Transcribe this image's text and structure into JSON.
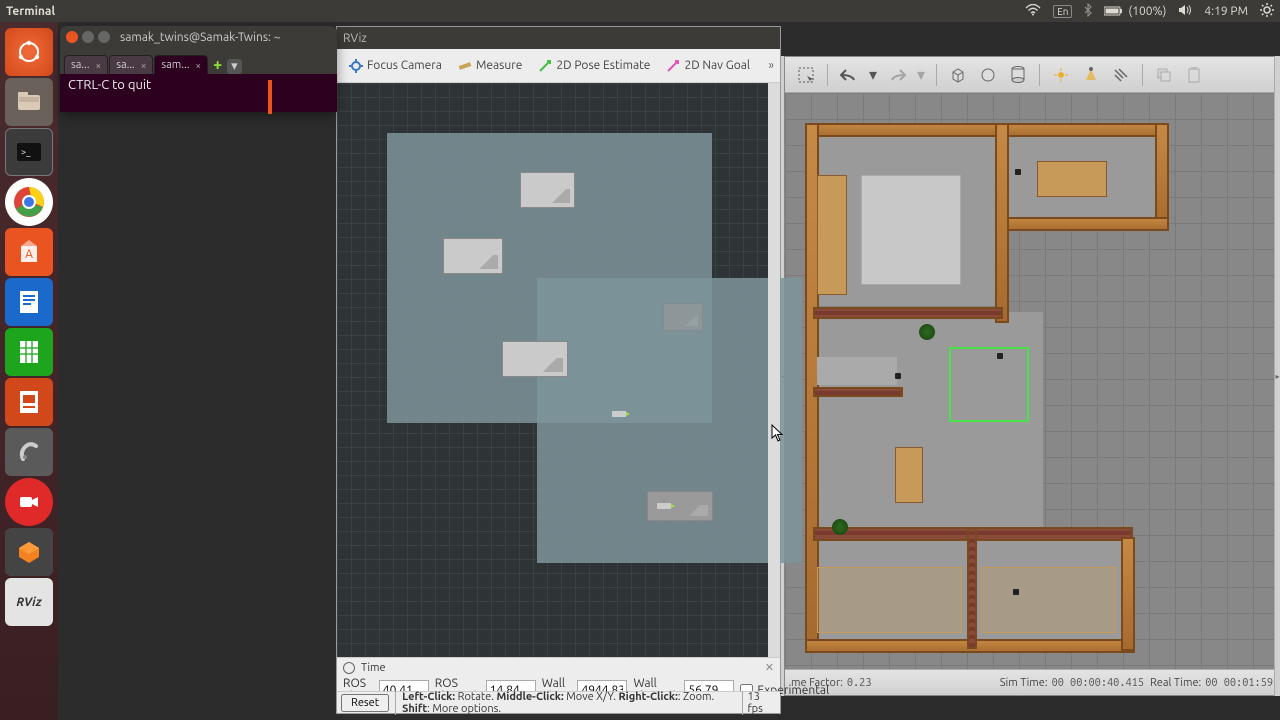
{
  "topbar": {
    "app": "Terminal",
    "lang": "En",
    "battery": "(100%)",
    "time": "4:19 PM"
  },
  "launcher": {
    "items": [
      "logo",
      "files",
      "terminal",
      "chrome",
      "software",
      "writer",
      "calc",
      "impress",
      "settings",
      "record",
      "gazebo",
      "rviz"
    ]
  },
  "terminal": {
    "title": "samak_twins@Samak-Twins: ~",
    "tabs": [
      {
        "label": "sa...",
        "active": false
      },
      {
        "label": "sa...",
        "active": false
      },
      {
        "label": "sam...",
        "active": true
      }
    ],
    "body": "CTRL-C to quit"
  },
  "rviz": {
    "title": "RViz",
    "toolbar": {
      "focus_camera": "Focus Camera",
      "measure": "Measure",
      "pose_estimate": "2D Pose Estimate",
      "nav_goal": "2D Nav Goal"
    },
    "time_panel": {
      "header": "Time",
      "ros_time_label": "ROS Time:",
      "ros_time": "40.41",
      "ros_elapsed_label": "ROS Elapsed:",
      "ros_elapsed": "14.84",
      "wall_time_label": "Wall Time:",
      "wall_time": "4944.83",
      "wall_elapsed_label": "Wall Elapsed:",
      "wall_elapsed": "56.79",
      "experimental": "Experimental"
    },
    "status": {
      "reset": "Reset",
      "hint_left": "Left-Click:",
      "hint_left_v": " Rotate. ",
      "hint_mid": "Middle-Click:",
      "hint_mid_v": " Move X/Y. ",
      "hint_right": "Right-Click:",
      "hint_right_v": ": Zoom. ",
      "hint_shift": "Shift",
      "hint_shift_v": ": More options.",
      "fps": "13 fps"
    }
  },
  "gazebo": {
    "status": {
      "factor_label": "me Factor:",
      "factor": "0.23",
      "sim_label": "Sim Time:",
      "sim": "00 00:00:40.415",
      "real_label": "Real Time:",
      "real": "00 00:01:59"
    }
  }
}
